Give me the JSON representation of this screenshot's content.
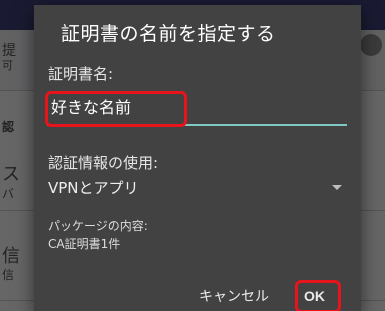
{
  "background": {
    "fragments": [
      "提",
      "可",
      "認",
      "ス",
      "バ",
      "信",
      "信"
    ]
  },
  "dialog": {
    "title": "証明書の名前を指定する",
    "name_label": "証明書名:",
    "name_value": "好きな名前",
    "credential_usage_label": "認証情報の使用:",
    "credential_usage_value": "VPNとアプリ",
    "package_contents_label": "パッケージの内容:",
    "package_contents_value": "CA証明書1件",
    "cancel_label": "キャンセル",
    "ok_label": "OK"
  },
  "colors": {
    "dialog_bg": "#424242",
    "accent_underline": "#7fc9c3",
    "highlight": "#e8141b"
  }
}
